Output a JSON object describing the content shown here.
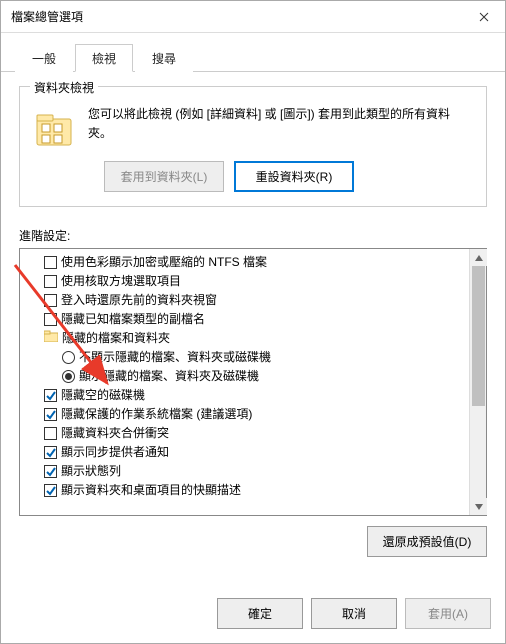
{
  "title": "檔案總管選項",
  "tabs": {
    "general": "一般",
    "view": "檢視",
    "search": "搜尋"
  },
  "folderViews": {
    "group": "資料夾檢視",
    "text": "您可以將此檢視 (例如 [詳細資料] 或 [圖示]) 套用到此類型的所有資料夾。",
    "apply": "套用到資料夾(L)",
    "reset": "重設資料夾(R)"
  },
  "advanced": {
    "label": "進階設定:",
    "items": [
      {
        "kind": "checkbox",
        "checked": false,
        "indent": 1,
        "text": "使用色彩顯示加密或壓縮的 NTFS 檔案"
      },
      {
        "kind": "checkbox",
        "checked": false,
        "indent": 1,
        "text": "使用核取方塊選取項目"
      },
      {
        "kind": "checkbox",
        "checked": false,
        "indent": 1,
        "text": "登入時還原先前的資料夾視窗"
      },
      {
        "kind": "checkbox",
        "checked": false,
        "indent": 1,
        "text": "隱藏已知檔案類型的副檔名"
      },
      {
        "kind": "group",
        "indent": 1,
        "text": "隱藏的檔案和資料夾"
      },
      {
        "kind": "radio",
        "checked": false,
        "indent": 2,
        "text": "不顯示隱藏的檔案、資料夾或磁碟機"
      },
      {
        "kind": "radio",
        "checked": true,
        "indent": 2,
        "text": "顯示隱藏的檔案、資料夾及磁碟機"
      },
      {
        "kind": "checkbox",
        "checked": true,
        "indent": 1,
        "text": "隱藏空的磁碟機"
      },
      {
        "kind": "checkbox",
        "checked": true,
        "indent": 1,
        "text": "隱藏保護的作業系統檔案 (建議選項)"
      },
      {
        "kind": "checkbox",
        "checked": false,
        "indent": 1,
        "text": "隱藏資料夾合併衝突"
      },
      {
        "kind": "checkbox",
        "checked": true,
        "indent": 1,
        "text": "顯示同步提供者通知"
      },
      {
        "kind": "checkbox",
        "checked": true,
        "indent": 1,
        "text": "顯示狀態列"
      },
      {
        "kind": "checkbox",
        "checked": true,
        "indent": 1,
        "text": "顯示資料夾和桌面項目的快顯描述"
      }
    ],
    "restore": "還原成預設值(D)"
  },
  "footer": {
    "ok": "確定",
    "cancel": "取消",
    "apply": "套用(A)"
  }
}
